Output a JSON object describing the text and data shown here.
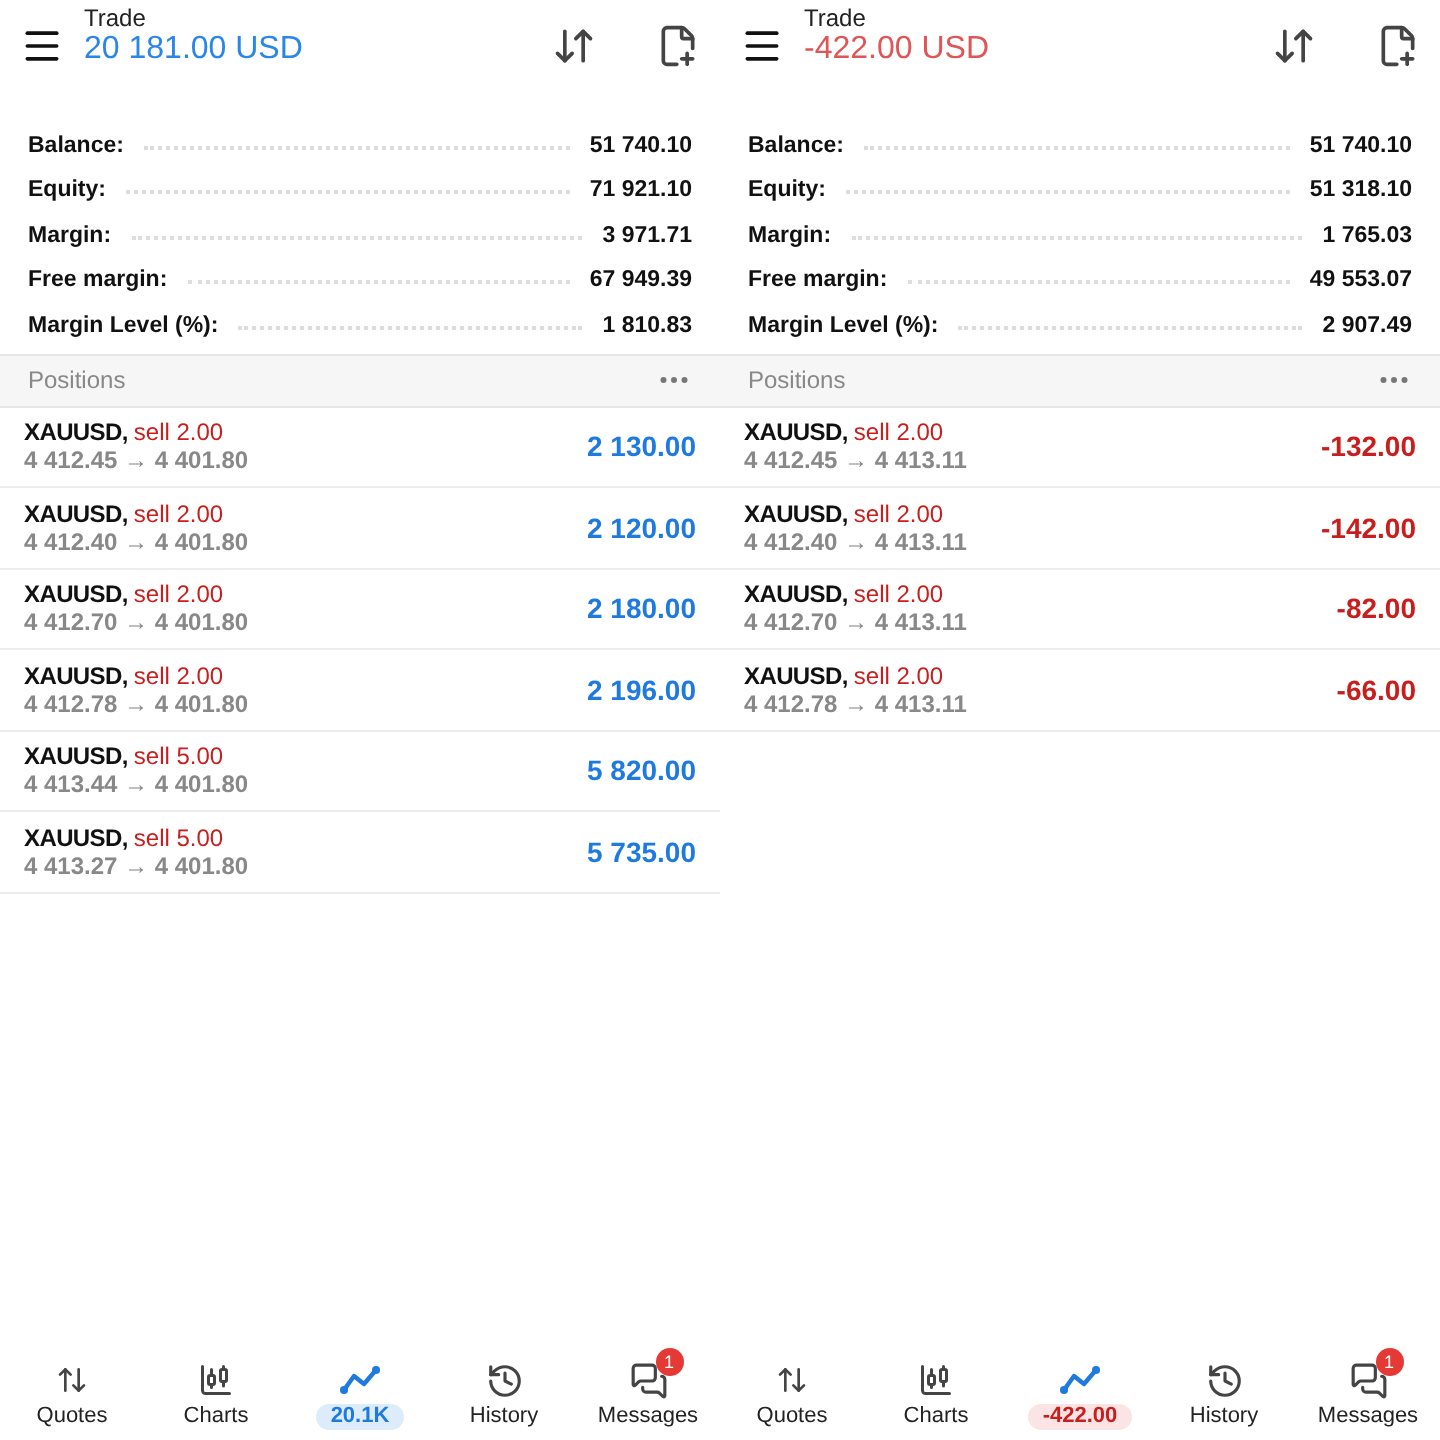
{
  "panels": [
    {
      "header": {
        "title": "Trade",
        "total": "20 181.00 USD",
        "kind": "profit"
      },
      "summary": [
        {
          "label": "Balance:",
          "value": "51 740.10"
        },
        {
          "label": "Equity:",
          "value": "71 921.10"
        },
        {
          "label": "Margin:",
          "value": "3 971.71"
        },
        {
          "label": "Free margin:",
          "value": "67 949.39"
        },
        {
          "label": "Margin Level (%):",
          "value": "1 810.83"
        }
      ],
      "positions_title": "Positions",
      "positions": [
        {
          "symbol": "XAUUSD,",
          "side": "sell 2.00",
          "prices": "4 412.45 → 4 401.80",
          "profit": "2 130.00",
          "kind": "profit"
        },
        {
          "symbol": "XAUUSD,",
          "side": "sell 2.00",
          "prices": "4 412.40 → 4 401.80",
          "profit": "2 120.00",
          "kind": "profit"
        },
        {
          "symbol": "XAUUSD,",
          "side": "sell 2.00",
          "prices": "4 412.70 → 4 401.80",
          "profit": "2 180.00",
          "kind": "profit"
        },
        {
          "symbol": "XAUUSD,",
          "side": "sell 2.00",
          "prices": "4 412.78 → 4 401.80",
          "profit": "2 196.00",
          "kind": "profit"
        },
        {
          "symbol": "XAUUSD,",
          "side": "sell 5.00",
          "prices": "4 413.44 → 4 401.80",
          "profit": "5 820.00",
          "kind": "profit"
        },
        {
          "symbol": "XAUUSD,",
          "side": "sell 5.00",
          "prices": "4 413.27 → 4 401.80",
          "profit": "5 735.00",
          "kind": "profit"
        }
      ],
      "nav": [
        {
          "kind": "quotes",
          "label": "Quotes",
          "selected": false
        },
        {
          "kind": "charts",
          "label": "Charts",
          "selected": false
        },
        {
          "kind": "trade",
          "label": "20.1K",
          "selected": true
        },
        {
          "kind": "history",
          "label": "History",
          "selected": false
        },
        {
          "kind": "messages",
          "label": "Messages",
          "selected": false,
          "badge": "1"
        }
      ]
    },
    {
      "header": {
        "title": "Trade",
        "total": "-422.00 USD",
        "kind": "loss"
      },
      "summary": [
        {
          "label": "Balance:",
          "value": "51 740.10"
        },
        {
          "label": "Equity:",
          "value": "51 318.10"
        },
        {
          "label": "Margin:",
          "value": "1 765.03"
        },
        {
          "label": "Free margin:",
          "value": "49 553.07"
        },
        {
          "label": "Margin Level (%):",
          "value": "2 907.49"
        }
      ],
      "positions_title": "Positions",
      "positions": [
        {
          "symbol": "XAUUSD,",
          "side": "sell 2.00",
          "prices": "4 412.45 → 4 413.11",
          "profit": "-132.00",
          "kind": "loss"
        },
        {
          "symbol": "XAUUSD,",
          "side": "sell 2.00",
          "prices": "4 412.40 → 4 413.11",
          "profit": "-142.00",
          "kind": "loss"
        },
        {
          "symbol": "XAUUSD,",
          "side": "sell 2.00",
          "prices": "4 412.70 → 4 413.11",
          "profit": "-82.00",
          "kind": "loss"
        },
        {
          "symbol": "XAUUSD,",
          "side": "sell 2.00",
          "prices": "4 412.78 → 4 413.11",
          "profit": "-66.00",
          "kind": "loss"
        }
      ],
      "nav": [
        {
          "kind": "quotes",
          "label": "Quotes",
          "selected": false
        },
        {
          "kind": "charts",
          "label": "Charts",
          "selected": false
        },
        {
          "kind": "trade",
          "label": "-422.00",
          "selected": true
        },
        {
          "kind": "history",
          "label": "History",
          "selected": false
        },
        {
          "kind": "messages",
          "label": "Messages",
          "selected": false,
          "badge": "1"
        }
      ]
    }
  ]
}
